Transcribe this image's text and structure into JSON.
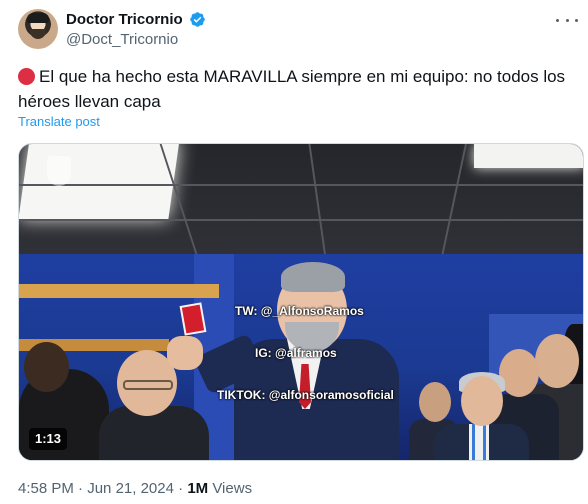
{
  "author": {
    "name": "Doctor Tricornio",
    "handle": "@Doct_Tricornio",
    "verified": true,
    "avatar_icon": "avatar-image"
  },
  "post": {
    "emoji": "red-circle",
    "text": "El que ha hecho esta MARAVILLA siempre en mi equipo: no todos los héroes llevan capa",
    "translate_label": "Translate post"
  },
  "media": {
    "type": "video",
    "duration": "1:13",
    "watermark": {
      "line1": "TW: @_AlfonsoRamos",
      "line2": "IG: @alframos",
      "line3": "TIKTOK: @alfonsoramosoficial"
    }
  },
  "meta": {
    "time": "4:58 PM",
    "separator": "·",
    "date": "Jun 21, 2024",
    "views_count": "1M",
    "views_label": "Views"
  },
  "colors": {
    "text_primary": "#0f1419",
    "text_secondary": "#536471",
    "link": "#1d9bf0",
    "verified": "#1d9bf0",
    "emoji_red": "#dd2e44"
  }
}
